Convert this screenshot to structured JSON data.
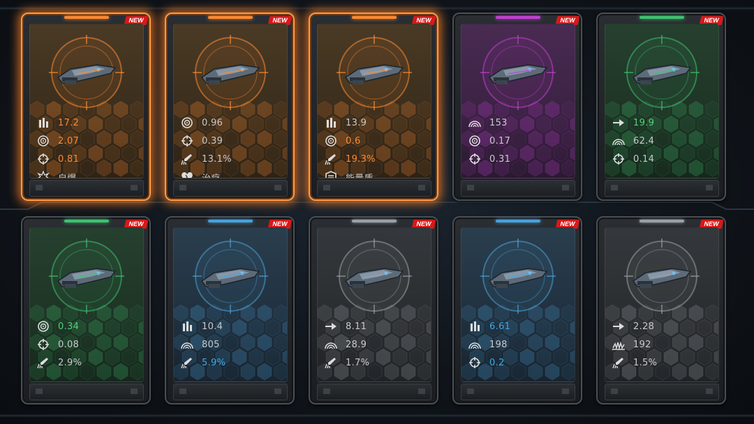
{
  "colors": {
    "orange": "#ff8a30",
    "green": "#54d07e",
    "blue": "#3fa8e6",
    "stat_text": "#c7c9cb",
    "badge": "#d61a1a",
    "selected_glow": "#ff9b45"
  },
  "cards": [
    {
      "tier": "orange",
      "selected": true,
      "badge": "NEW",
      "stats": [
        {
          "icon": "ammo-icon",
          "value": "17.2",
          "highlight": "orange"
        },
        {
          "icon": "fire-rate-icon",
          "value": "2.07",
          "highlight": "orange"
        },
        {
          "icon": "crosshair-icon",
          "value": "0.81",
          "highlight": "orange"
        },
        {
          "icon": "explode-icon",
          "value": "自爆",
          "highlight": ""
        }
      ]
    },
    {
      "tier": "orange",
      "selected": true,
      "badge": "NEW",
      "stats": [
        {
          "icon": "fire-rate-icon",
          "value": "0.96",
          "highlight": ""
        },
        {
          "icon": "crosshair-icon",
          "value": "0.39",
          "highlight": ""
        },
        {
          "icon": "missile-icon",
          "value": "13.1%",
          "highlight": ""
        },
        {
          "icon": "heal-icon",
          "value": "治疗",
          "highlight": ""
        }
      ]
    },
    {
      "tier": "orange",
      "selected": true,
      "badge": "NEW",
      "stats": [
        {
          "icon": "ammo-icon",
          "value": "13.9",
          "highlight": ""
        },
        {
          "icon": "fire-rate-icon",
          "value": "0.6",
          "highlight": "orange"
        },
        {
          "icon": "missile-icon",
          "value": "19.3%",
          "highlight": "orange"
        },
        {
          "icon": "shield-icon",
          "value": "能量盾",
          "highlight": ""
        }
      ]
    },
    {
      "tier": "purple",
      "selected": false,
      "badge": "NEW",
      "stats": [
        {
          "icon": "radar-icon",
          "value": "153",
          "highlight": ""
        },
        {
          "icon": "fire-rate-icon",
          "value": "0.17",
          "highlight": ""
        },
        {
          "icon": "crosshair-icon",
          "value": "0.31",
          "highlight": ""
        }
      ]
    },
    {
      "tier": "green",
      "selected": false,
      "badge": "NEW",
      "stats": [
        {
          "icon": "speed-arrow-icon",
          "value": "19.9",
          "highlight": "green"
        },
        {
          "icon": "radar-icon",
          "value": "62.4",
          "highlight": ""
        },
        {
          "icon": "crosshair-icon",
          "value": "0.14",
          "highlight": ""
        }
      ]
    },
    {
      "tier": "green",
      "selected": false,
      "badge": "NEW",
      "stats": [
        {
          "icon": "fire-rate-icon",
          "value": "0.34",
          "highlight": "green"
        },
        {
          "icon": "crosshair-icon",
          "value": "0.08",
          "highlight": ""
        },
        {
          "icon": "missile-icon",
          "value": "2.9%",
          "highlight": ""
        }
      ]
    },
    {
      "tier": "blue",
      "selected": false,
      "badge": "NEW",
      "stats": [
        {
          "icon": "ammo-icon",
          "value": "10.4",
          "highlight": ""
        },
        {
          "icon": "radar-icon",
          "value": "805",
          "highlight": ""
        },
        {
          "icon": "missile-icon",
          "value": "5.9%",
          "highlight": "blue"
        }
      ]
    },
    {
      "tier": "gray",
      "selected": false,
      "badge": "NEW",
      "stats": [
        {
          "icon": "speed-arrow-icon",
          "value": "8.11",
          "highlight": ""
        },
        {
          "icon": "radar-icon",
          "value": "28.9",
          "highlight": ""
        },
        {
          "icon": "missile-icon",
          "value": "1.7%",
          "highlight": ""
        }
      ]
    },
    {
      "tier": "blue",
      "selected": false,
      "badge": "NEW",
      "stats": [
        {
          "icon": "ammo-icon",
          "value": "6.61",
          "highlight": "blue"
        },
        {
          "icon": "radar-icon",
          "value": "198",
          "highlight": ""
        },
        {
          "icon": "crosshair-icon",
          "value": "0.2",
          "highlight": "blue"
        }
      ]
    },
    {
      "tier": "gray",
      "selected": false,
      "badge": "NEW",
      "stats": [
        {
          "icon": "speed-arrow-icon",
          "value": "2.28",
          "highlight": ""
        },
        {
          "icon": "spread-icon",
          "value": "192",
          "highlight": ""
        },
        {
          "icon": "missile-icon",
          "value": "1.5%",
          "highlight": ""
        }
      ]
    }
  ]
}
